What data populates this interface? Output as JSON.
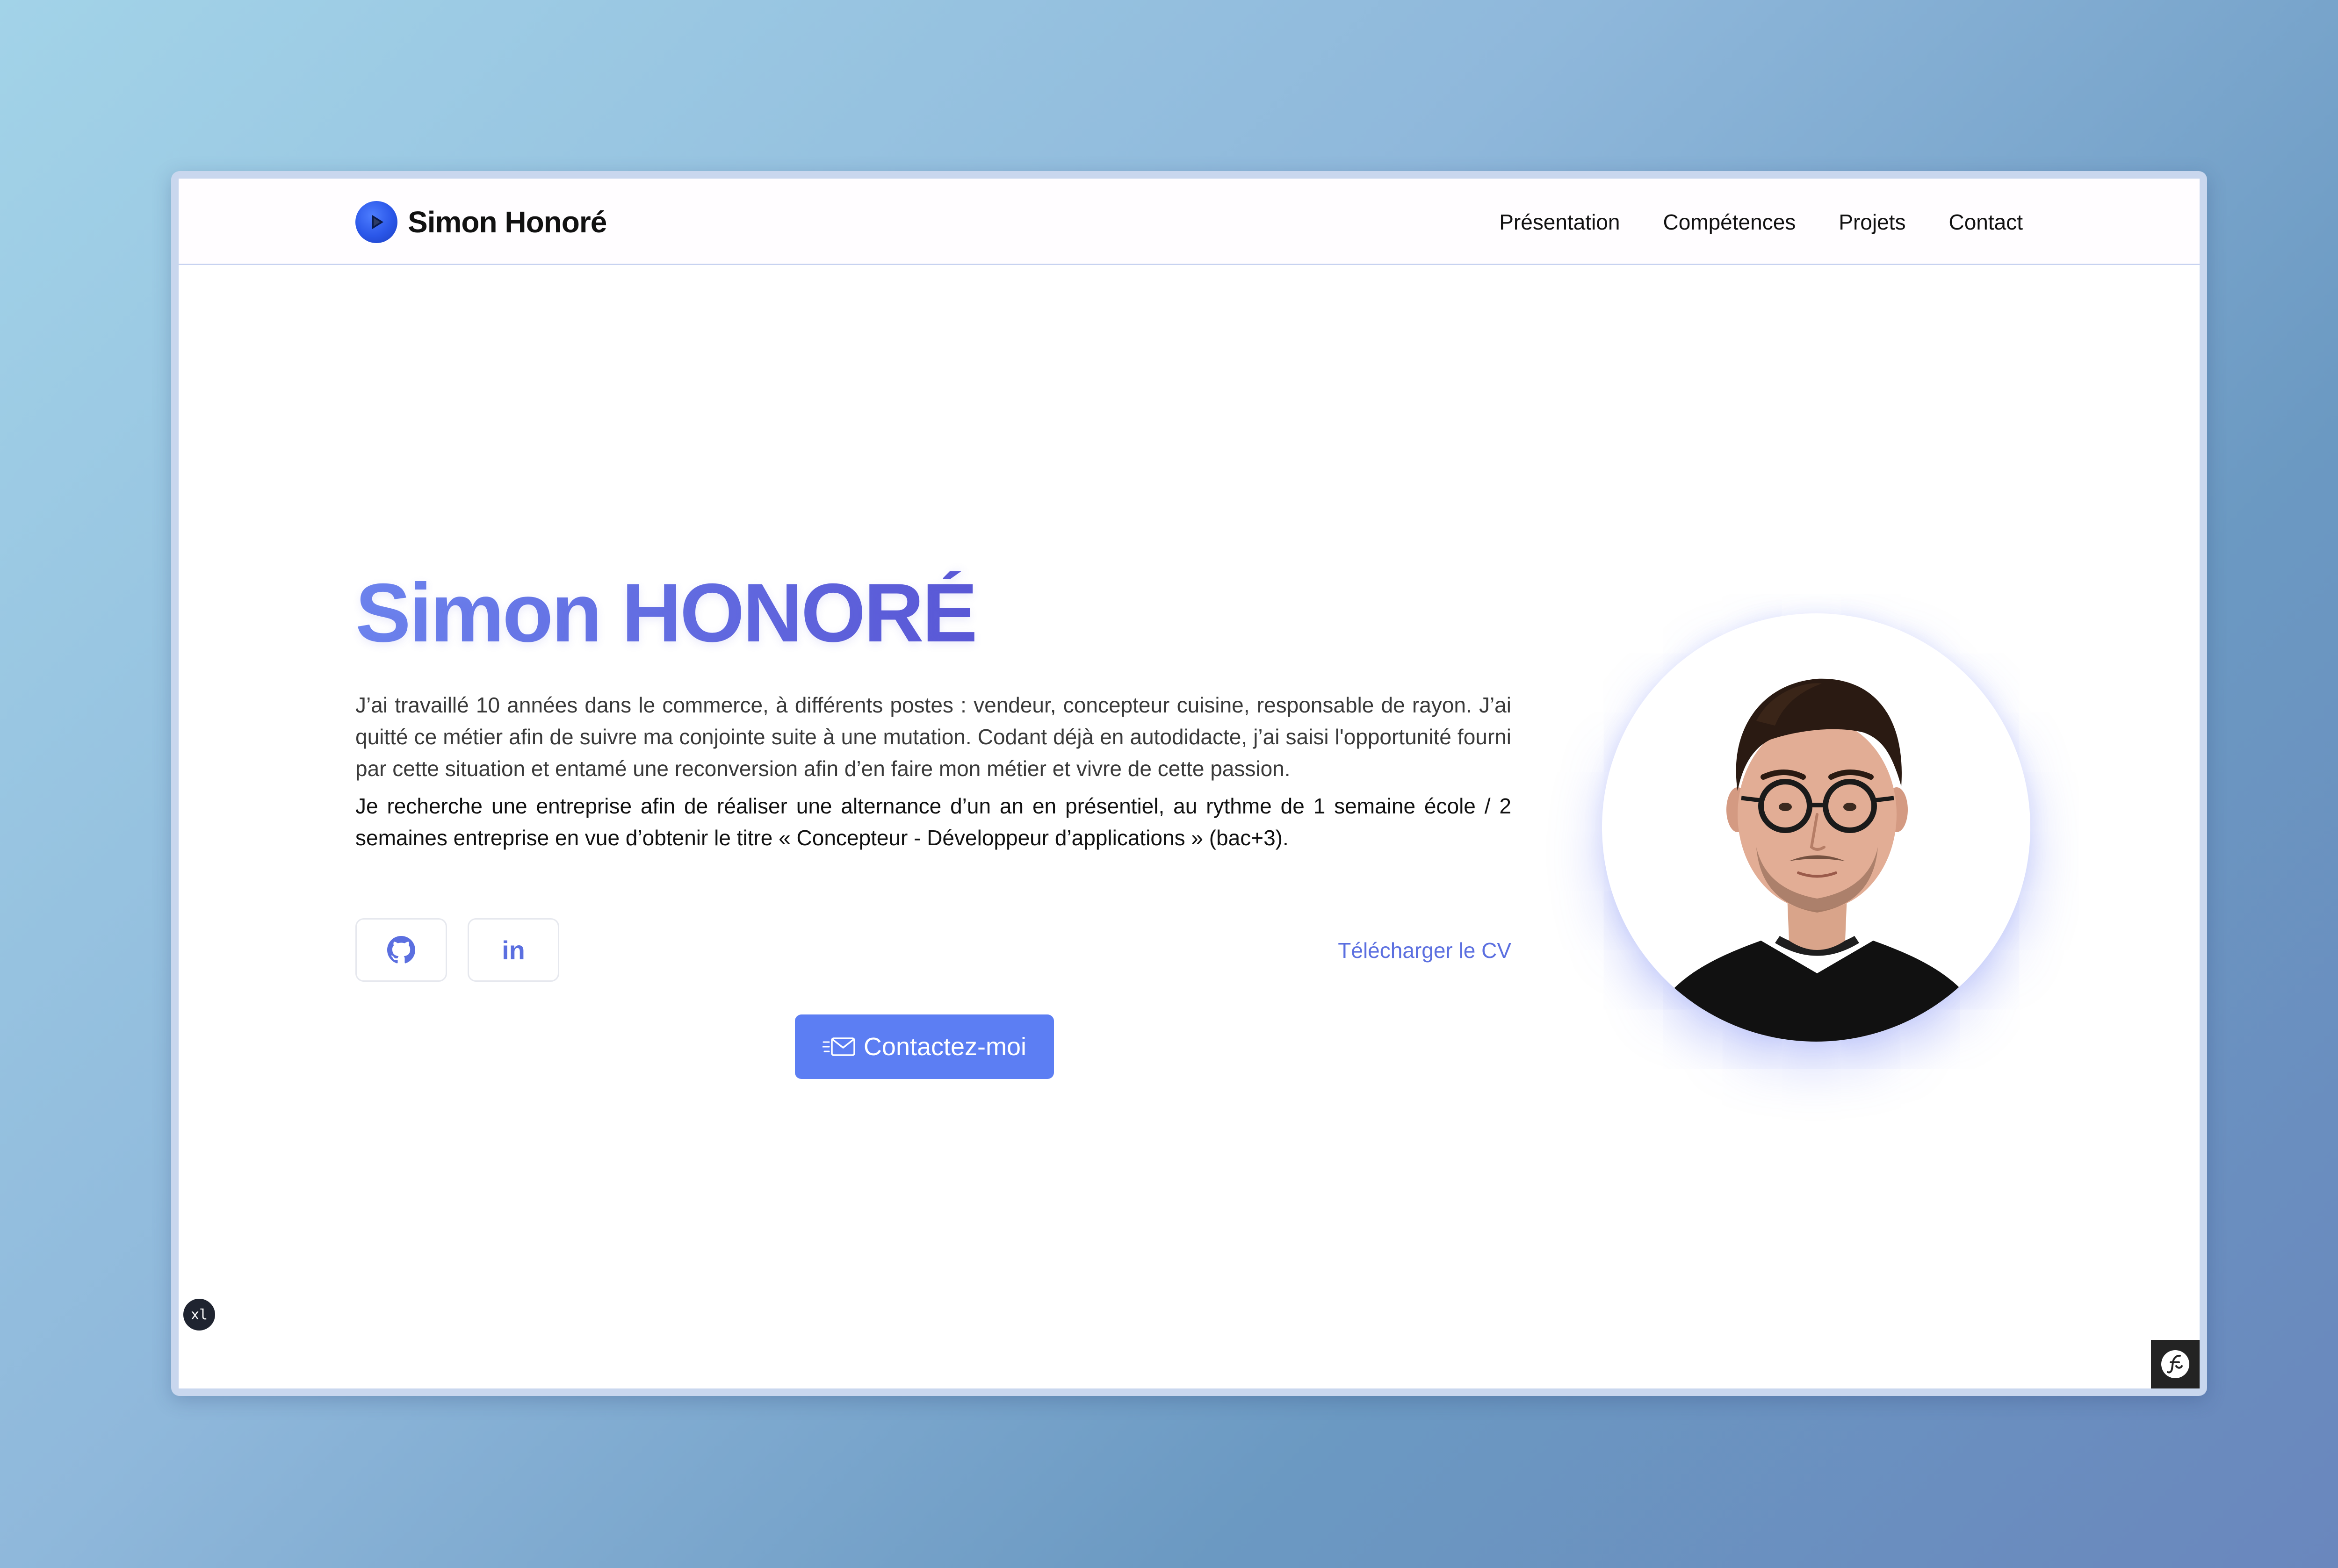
{
  "header": {
    "brand_name": "Simon Honoré",
    "nav": [
      {
        "label": "Présentation"
      },
      {
        "label": "Compétences"
      },
      {
        "label": "Projets"
      },
      {
        "label": "Contact"
      }
    ]
  },
  "hero": {
    "title": "Simon HONORÉ",
    "paragraph_1": "J’ai travaillé 10 années dans le commerce, à différents postes : vendeur, concepteur cuisine, responsable de rayon. J’ai quitté ce métier afin de suivre ma conjointe suite à une mutation. Codant déjà en autodidacte, j’ai saisi l'opportunité fourni par cette situation et entamé une reconversion afin d’en faire mon métier et vivre de cette passion.",
    "paragraph_2": "Je recherche une entreprise afin de réaliser une alternance d’un an en présentiel, au rythme de 1 semaine école / 2 semaines entreprise en vue d’obtenir le titre « Concepteur - Développeur d’applications » (bac+3).",
    "linkedin_label": "in",
    "cv_link": "Télécharger le CV",
    "contact_button": "Contactez-moi"
  },
  "badges": {
    "breakpoint": "xl"
  },
  "icons": {
    "brand": "play-circle-icon",
    "github": "github-icon",
    "linkedin": "linkedin-icon",
    "contact": "mail-send-icon",
    "debug": "symfony-icon"
  },
  "colors": {
    "accent": "#5c7ef3",
    "title_gradient_start": "#6e86ef",
    "title_gradient_end": "#5a58d6",
    "link": "#5b6fe0"
  }
}
